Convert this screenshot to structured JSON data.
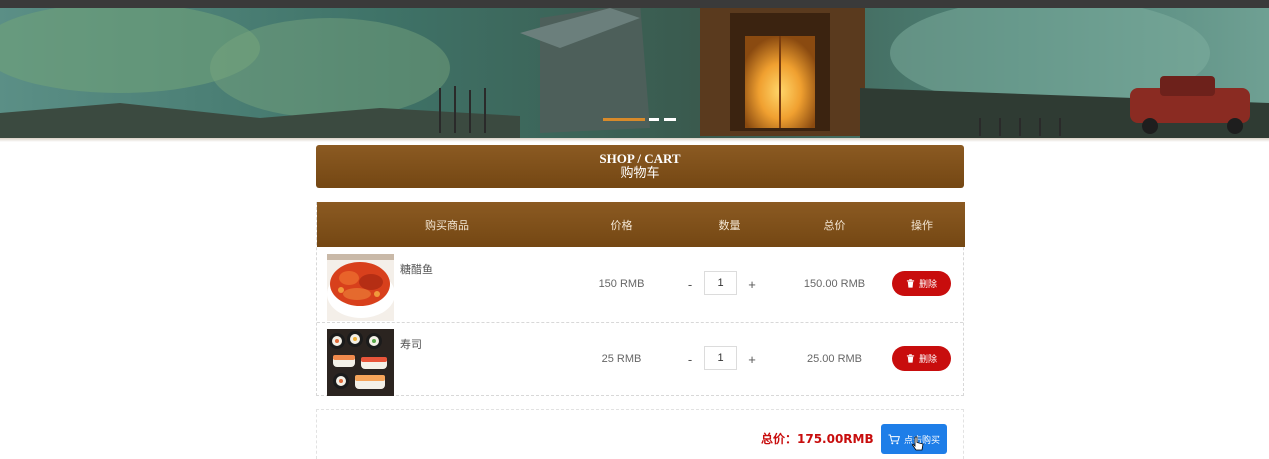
{
  "banner": {
    "image": "night-village-illustration",
    "slide_count": 3,
    "active_slide": 1
  },
  "header": {
    "title_en": "SHOP / CART",
    "title_cn": "购物车"
  },
  "table": {
    "columns": [
      "购买商品",
      "价格",
      "数量",
      "总价",
      "操作"
    ],
    "rows": [
      {
        "image": "sweet-sour-fish-photo",
        "name": "糖醋鱼",
        "price": "150 RMB",
        "minus": "-",
        "quantity": "1",
        "plus": "+",
        "total": "150.00 RMB",
        "delete_label": "删除"
      },
      {
        "image": "sushi-photo",
        "name": "寿司",
        "price": "25 RMB",
        "minus": "-",
        "quantity": "1",
        "plus": "+",
        "total": "25.00 RMB",
        "delete_label": "删除"
      }
    ]
  },
  "footer": {
    "sum_label": "总价：175.00RMB",
    "buy_label": "点击购买"
  },
  "icons": {
    "delete": "trash-icon",
    "buy": "cart-icon"
  },
  "colors": {
    "brown_bar": "#7c4e18",
    "danger": "#c80d0d",
    "primary": "#1e7ee8"
  }
}
